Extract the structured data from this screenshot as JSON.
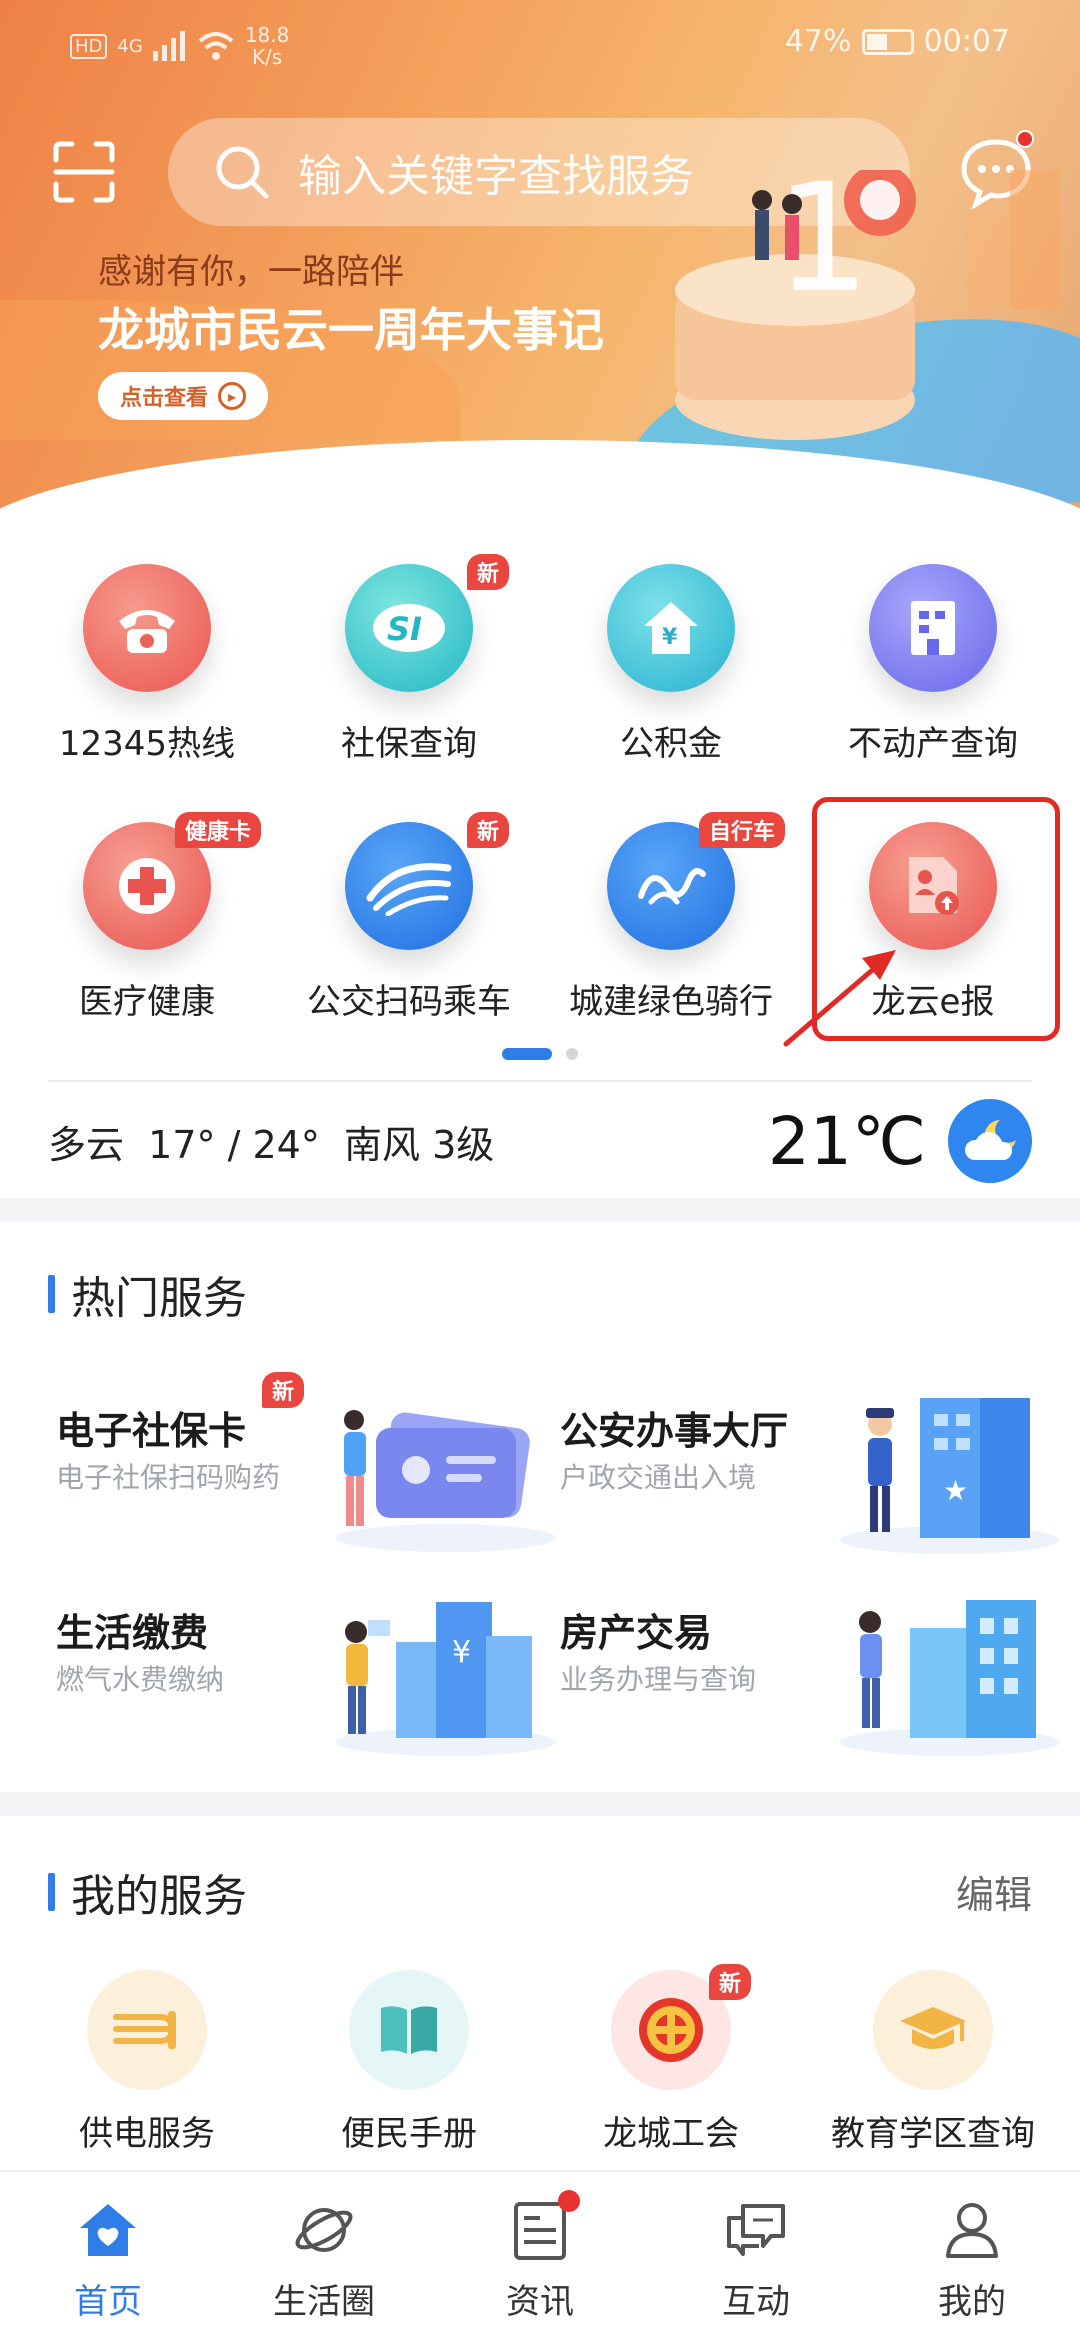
{
  "status_bar": {
    "hd": "HD",
    "network": "4G",
    "speed_value": "18.8",
    "speed_unit": "K/s",
    "battery": "47%",
    "time": "00:07"
  },
  "search": {
    "placeholder": "输入关键字查找服务"
  },
  "banner": {
    "subtitle": "感谢有你，一路陪伴",
    "title": "龙城市民云一周年大事记",
    "button": "点击查看",
    "active_slide": 3,
    "slide_count": 5
  },
  "quick_services": [
    {
      "label": "12345热线",
      "badge": "",
      "icon": "phone-icon",
      "color": "#ef6a62"
    },
    {
      "label": "社保查询",
      "badge": "新",
      "icon": "social-security-icon",
      "color": "#36c3c9"
    },
    {
      "label": "公积金",
      "badge": "",
      "icon": "housing-fund-icon",
      "color": "#3cc2cf"
    },
    {
      "label": "不动产查询",
      "badge": "",
      "icon": "building-icon",
      "color": "#7b7df0"
    },
    {
      "label": "医疗健康",
      "badge": "健康卡",
      "icon": "medical-cross-icon",
      "color": "#ee6a62"
    },
    {
      "label": "公交扫码乘车",
      "badge": "新",
      "icon": "bus-icon",
      "color": "#2f7ee8"
    },
    {
      "label": "城建绿色骑行",
      "badge": "自行车",
      "icon": "bicycle-icon",
      "color": "#2f7ee8"
    },
    {
      "label": "龙云e报",
      "badge": "",
      "icon": "e-report-icon",
      "color": "#ef6a62"
    }
  ],
  "grid_pages": {
    "current": 1,
    "total": 2
  },
  "weather": {
    "description": "多云  17° / 24°  南风 3级",
    "temperature": "21℃",
    "icon": "cloudy-moon-icon"
  },
  "hot_services": {
    "title": "热门服务",
    "items": [
      {
        "title": "电子社保卡",
        "subtitle": "电子社保扫码购药",
        "badge": "新"
      },
      {
        "title": "公安办事大厅",
        "subtitle": "户政交通出入境",
        "badge": ""
      },
      {
        "title": "生活缴费",
        "subtitle": "燃气水费缴纳",
        "badge": ""
      },
      {
        "title": "房产交易",
        "subtitle": "业务办理与查询",
        "badge": ""
      }
    ]
  },
  "my_services": {
    "title": "我的服务",
    "edit": "编辑",
    "items": [
      {
        "label": "供电服务",
        "badge": "",
        "icon": "power-icon"
      },
      {
        "label": "便民手册",
        "badge": "",
        "icon": "book-icon"
      },
      {
        "label": "龙城工会",
        "badge": "新",
        "icon": "union-emblem-icon"
      },
      {
        "label": "教育学区查询",
        "badge": "",
        "icon": "graduation-cap-icon"
      }
    ]
  },
  "tabs": [
    {
      "label": "首页",
      "icon": "home-icon",
      "active": true
    },
    {
      "label": "生活圈",
      "icon": "planet-icon",
      "active": false
    },
    {
      "label": "资讯",
      "icon": "news-icon",
      "active": false
    },
    {
      "label": "互动",
      "icon": "chat-icon",
      "active": false
    },
    {
      "label": "我的",
      "icon": "profile-icon",
      "active": false
    }
  ],
  "colors": {
    "accent": "#2f7ee8",
    "badge": "#e8463e",
    "highlight": "#e02a23",
    "banner": "#ef8045"
  }
}
